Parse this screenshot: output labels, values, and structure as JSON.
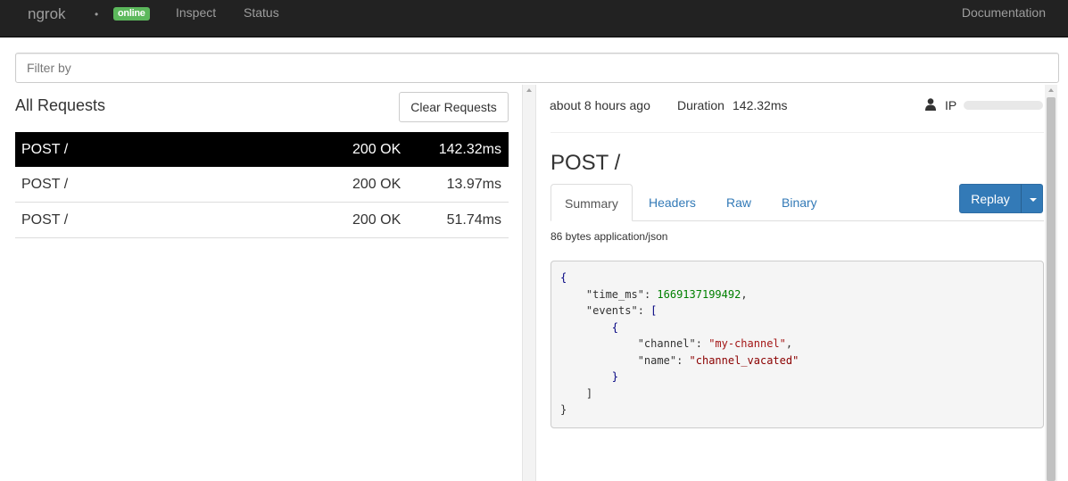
{
  "navbar": {
    "brand": "ngrok",
    "dot": "•",
    "status_badge": "online",
    "links": {
      "inspect": "Inspect",
      "status": "Status",
      "documentation": "Documentation"
    }
  },
  "filter": {
    "placeholder": "Filter by",
    "value": ""
  },
  "requests_pane": {
    "title": "All Requests",
    "clear_button": "Clear Requests",
    "requests": [
      {
        "method_path": "POST /",
        "status": "200 OK",
        "duration": "142.32ms",
        "selected": true
      },
      {
        "method_path": "POST /",
        "status": "200 OK",
        "duration": "13.97ms",
        "selected": false
      },
      {
        "method_path": "POST /",
        "status": "200 OK",
        "duration": "51.74ms",
        "selected": false
      }
    ]
  },
  "detail": {
    "time_ago": "about 8 hours ago",
    "duration_label": "Duration",
    "duration_value": "142.32ms",
    "ip_label": "IP",
    "title": "POST /",
    "tabs": {
      "summary": "Summary",
      "headers": "Headers",
      "raw": "Raw",
      "binary": "Binary"
    },
    "active_tab": "Summary",
    "replay_button": "Replay",
    "content_info": "86 bytes application/json",
    "body_json": {
      "open_brace": "{",
      "time_ms_key": "\"time_ms\"",
      "time_ms_value": "1669137199492",
      "events_key": "\"events\"",
      "open_bracket": "[",
      "inner_open": "{",
      "channel_key": "\"channel\"",
      "channel_value": "\"my-channel\"",
      "name_key": "\"name\"",
      "name_value": "\"channel_vacated\"",
      "inner_close": "}",
      "close_bracket": "]",
      "close_brace": "}"
    }
  },
  "colors": {
    "navbar_bg": "#222222",
    "badge_green": "#5cb85c",
    "link_blue": "#337ab7",
    "selected_row_bg": "#000000",
    "json_number": "#008000",
    "json_string": "#a31515"
  },
  "icons": {
    "user": "user-icon",
    "caret": "caret-down-icon"
  }
}
